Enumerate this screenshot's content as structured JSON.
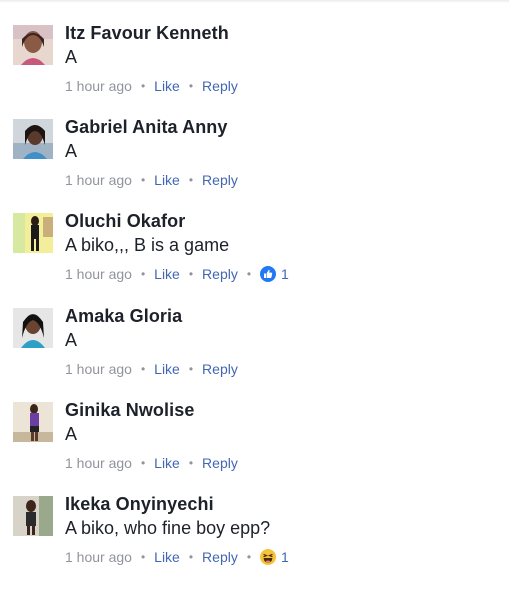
{
  "colors": {
    "author": "#1d2129",
    "meta": "#90949c",
    "action": "#4267b2",
    "like_reaction": "#2078f4",
    "haha_reaction": "#f5c33b"
  },
  "comments": [
    {
      "author": "Itz Favour Kenneth",
      "text": "A",
      "time": "1 hour ago",
      "like_label": "Like",
      "reply_label": "Reply",
      "avatar_icon": "profile-photo"
    },
    {
      "author": "Gabriel Anita Anny",
      "text": "A",
      "time": "1 hour ago",
      "like_label": "Like",
      "reply_label": "Reply",
      "avatar_icon": "profile-photo"
    },
    {
      "author": "Oluchi Okafor",
      "text": "A biko,,, B is a game",
      "time": "1 hour ago",
      "like_label": "Like",
      "reply_label": "Reply",
      "avatar_icon": "profile-photo",
      "reaction": {
        "icon": "like-reaction-icon",
        "count": "1"
      }
    },
    {
      "author": "Amaka Gloria",
      "text": "A",
      "time": "1 hour ago",
      "like_label": "Like",
      "reply_label": "Reply",
      "avatar_icon": "profile-photo"
    },
    {
      "author": "Ginika Nwolise",
      "text": "A",
      "time": "1 hour ago",
      "like_label": "Like",
      "reply_label": "Reply",
      "avatar_icon": "profile-photo"
    },
    {
      "author": "Ikeka Onyinyechi",
      "text": "A biko, who fine boy epp?",
      "time": "1 hour ago",
      "like_label": "Like",
      "reply_label": "Reply",
      "avatar_icon": "profile-photo",
      "reaction": {
        "icon": "haha-reaction-icon",
        "count": "1"
      }
    }
  ]
}
